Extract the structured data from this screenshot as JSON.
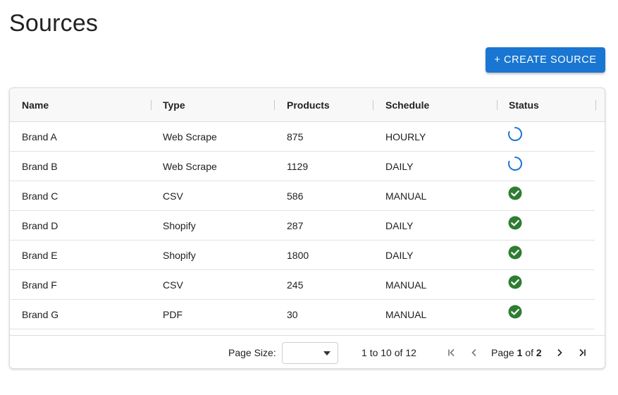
{
  "page": {
    "title": "Sources"
  },
  "toolbar": {
    "create_label": "+ CREATE SOURCE"
  },
  "table": {
    "columns": [
      "Name",
      "Type",
      "Products",
      "Schedule",
      "Status"
    ],
    "rows": [
      {
        "name": "Brand A",
        "type": "Web Scrape",
        "products": "875",
        "schedule": "HOURLY",
        "status": "loading"
      },
      {
        "name": "Brand B",
        "type": "Web Scrape",
        "products": "1129",
        "schedule": "DAILY",
        "status": "loading"
      },
      {
        "name": "Brand C",
        "type": "CSV",
        "products": "586",
        "schedule": "MANUAL",
        "status": "success"
      },
      {
        "name": "Brand D",
        "type": "Shopify",
        "products": "287",
        "schedule": "DAILY",
        "status": "success"
      },
      {
        "name": "Brand E",
        "type": "Shopify",
        "products": "1800",
        "schedule": "DAILY",
        "status": "success"
      },
      {
        "name": "Brand F",
        "type": "CSV",
        "products": "245",
        "schedule": "MANUAL",
        "status": "success"
      },
      {
        "name": "Brand G",
        "type": "PDF",
        "products": "30",
        "schedule": "MANUAL",
        "status": "success"
      }
    ]
  },
  "pagination": {
    "page_size_label": "Page Size:",
    "page_size_value": "",
    "range_prefix": "1",
    "range_to": "to",
    "range_end": "10",
    "range_of": "of",
    "range_total": "12",
    "page_word": "Page",
    "page_current": "1",
    "page_of": "of",
    "page_total": "2"
  },
  "colors": {
    "primary": "#1976d2",
    "spinner": "#1976d2",
    "success": "#2e7d32"
  },
  "icons": {
    "loading": "spinner-icon",
    "success": "check-circle-icon",
    "first": "first-page-icon",
    "prev": "chevron-left-icon",
    "next": "chevron-right-icon",
    "last": "last-page-icon",
    "dropdown": "caret-down-icon"
  }
}
